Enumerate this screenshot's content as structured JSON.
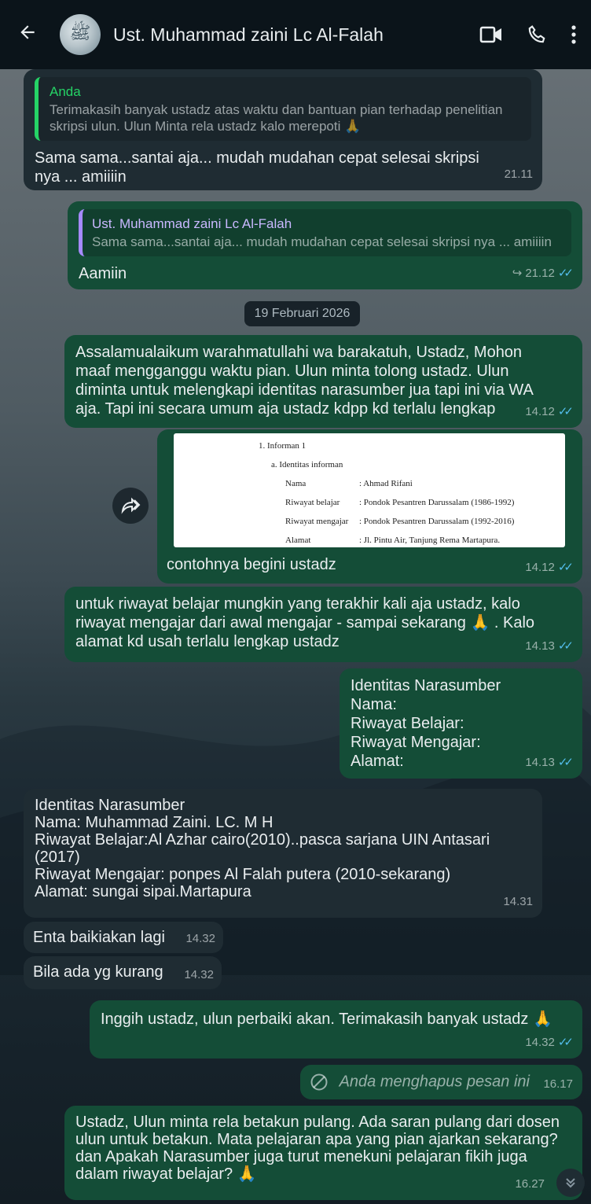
{
  "header": {
    "contact_name": "Ust. Muhammad zaini Lc Al-Falah",
    "avatar_text": "ﷺ",
    "back_icon": "arrow-left-icon",
    "video_icon": "video-camera-icon",
    "call_icon": "phone-icon",
    "menu_icon": "more-vertical-icon"
  },
  "messages": {
    "m1": {
      "quote_name": "Anda",
      "quote_text": "Terimakasih banyak ustadz atas waktu dan bantuan pian terhadap penelitian skripsi ulun. Ulun Minta rela ustadz kalo merepoti 🙏",
      "text": "Sama sama...santai aja... mudah mudahan cepat selesai skripsi nya ... amiiiin",
      "time": "21.11"
    },
    "m2": {
      "quote_name": "Ust. Muhammad zaini Lc Al-Falah",
      "quote_text": "Sama sama...santai aja... mudah mudahan cepat selesai skripsi nya ... amiiiin",
      "text": "Aamiin",
      "time": "21.12",
      "forward_glyph": "↪"
    },
    "date_divider": "19 Februari 2026",
    "m3": {
      "text": "Assalamualaikum warahmatullahi wa barakatuh, Ustadz, Mohon maaf mengganggu waktu pian. Ulun minta tolong ustadz. Ulun diminta untuk melengkapi identitas narasumber jua tapi ini via WA aja. Tapi ini secara umum aja ustadz kdpp kd terlalu lengkap",
      "time": "14.12"
    },
    "m4": {
      "doc_lines": [
        "1.   Informan 1",
        "a.   Identitas informan",
        "Nama",
        ": Ahmad Rifani",
        "Riwayat belajar",
        ": Pondok Pesantren Darussalam (1986-1992)",
        "Riwayat mengajar",
        ": Pondok Pesantren Darussalam (1992-2016)",
        "Alamat",
        ": Jl. Pintu Air, Tanjung Rema Martapura."
      ],
      "caption": "contohnya begini ustadz",
      "time": "14.12"
    },
    "m5": {
      "text": "untuk riwayat belajar mungkin yang terakhir kali aja ustadz, kalo riwayat mengajar dari awal mengajar - sampai sekarang 🙏 . Kalo alamat kd usah terlalu lengkap ustadz",
      "time": "14.13"
    },
    "m6": {
      "text": "Identitas Narasumber\nNama:\nRiwayat Belajar:\nRiwayat Mengajar:\nAlamat:",
      "time": "14.13"
    },
    "m7": {
      "text": "Identitas Narasumber\nNama: Muhammad Zaini. LC. M H\nRiwayat Belajar:Al Azhar cairo(2010)..pasca sarjana UIN Antasari (2017)\nRiwayat Mengajar: ponpes Al Falah putera (2010-sekarang)\nAlamat: sungai sipai.Martapura",
      "time": "14.31"
    },
    "m8": {
      "text": "Enta baikiakan lagi",
      "time": "14.32"
    },
    "m9": {
      "text": "Bila ada yg kurang",
      "time": "14.32"
    },
    "m10": {
      "text": "Inggih ustadz, ulun perbaiki akan. Terimakasih banyak ustadz 🙏",
      "time": "14.32"
    },
    "m11": {
      "text": "Anda menghapus pesan ini",
      "time": "16.17"
    },
    "m12": {
      "text": "Ustadz, Ulun minta rela betakun pulang. Ada saran pulang dari dosen ulun untuk betakun. Mata pelajaran apa yang pian ajarkan sekarang? dan Apakah Narasumber juga turut menekuni pelajaran fikih juga dalam riwayat belajar? 🙏",
      "time": "16.27"
    }
  },
  "ticks": "✓✓",
  "colors": {
    "header_bg": "#0b141a",
    "incoming_bubble": "#1f2c33",
    "outgoing_bubble": "#144d37",
    "read_tick": "#53bdeb"
  }
}
